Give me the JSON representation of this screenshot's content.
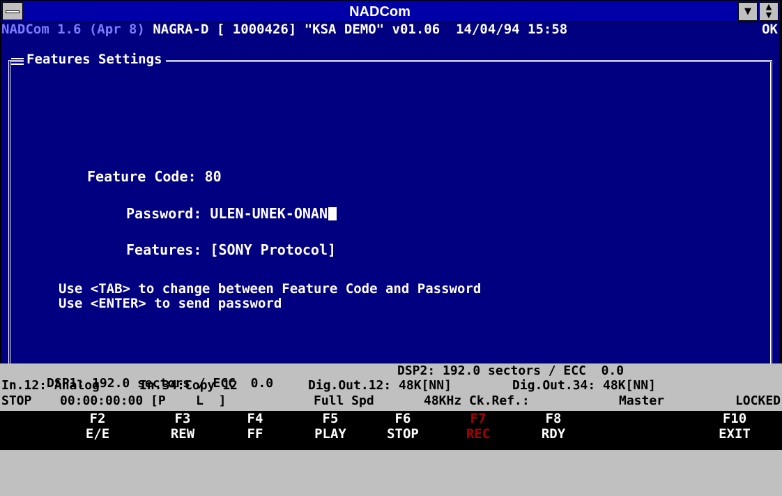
{
  "window": {
    "title": "NADCom"
  },
  "status_top": {
    "app": "NADCom 1.6 (Apr 8)",
    "device": "NAGRA-D [ 1000426] \"KSA DEMO\" v01.06",
    "datetime": "14/04/94 15:58",
    "state": "OK"
  },
  "panel": {
    "title": "Features Settings",
    "feature_code_label": "Feature Code:",
    "feature_code_value": "80",
    "password_label": "Password:",
    "password_value": "ULEN-UNEK-ONAN",
    "features_label": "Features:",
    "features_value": "[SONY Protocol]",
    "hint1": "Use <TAB> to change between Feature Code and Password",
    "hint2": "Use <ENTER> to send password"
  },
  "status_bottom": {
    "dsp1": "DSP1: 192.0 sectors / ECC  0.0",
    "dsp2": "DSP2: 192.0 sectors / ECC  0.0",
    "in12": "In.12: Analog",
    "in34": "In.34:Copy 12",
    "digout12": "Dig.Out.12: 48K[NN]",
    "digout34": "Dig.Out.34: 48K[NN]",
    "mode": "STOP",
    "timecode": "00:00:00:00 [P    L  ]",
    "speed": "Full Spd",
    "rate": "48KHz Ck.Ref.:",
    "clock": "Master",
    "lock": "LOCKED"
  },
  "fkeys": [
    {
      "key": "F2",
      "label": "E/E"
    },
    {
      "key": "F3",
      "label": "REW"
    },
    {
      "key": "F4",
      "label": "FF"
    },
    {
      "key": "F5",
      "label": "PLAY"
    },
    {
      "key": "F6",
      "label": "STOP"
    },
    {
      "key": "F7",
      "label": "REC"
    },
    {
      "key": "F8",
      "label": "RDY"
    },
    {
      "key": "F10",
      "label": "EXIT"
    }
  ]
}
